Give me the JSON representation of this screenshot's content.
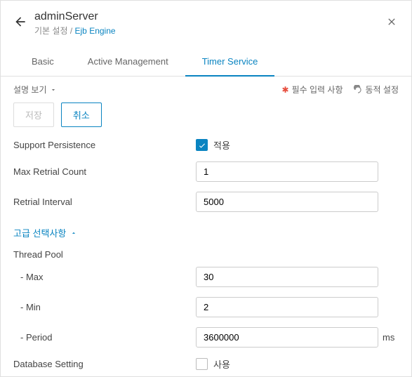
{
  "header": {
    "title": "adminServer",
    "breadcrumb_root": "기본 설정",
    "breadcrumb_sep": " / ",
    "breadcrumb_current": "Ejb Engine"
  },
  "tabs": {
    "t0": "Basic",
    "t1": "Active Management",
    "t2": "Timer Service"
  },
  "legend": {
    "view": "설명 보기",
    "required": "필수 입력 사항",
    "dynamic": "동적 설정"
  },
  "buttons": {
    "save": "저장",
    "cancel": "취소"
  },
  "fields": {
    "supportPersistence": {
      "label": "Support Persistence",
      "chkLabel": "적용"
    },
    "maxRetrial": {
      "label": "Max Retrial Count",
      "value": "1"
    },
    "retrialInterval": {
      "label": "Retrial Interval",
      "value": "5000"
    },
    "advanced": "고급 선택사항",
    "threadPool": "Thread Pool",
    "max": {
      "label": " - Max",
      "value": "30"
    },
    "min": {
      "label": " - Min",
      "value": "2"
    },
    "period": {
      "label": " - Period",
      "value": "3600000",
      "unit": "ms"
    },
    "dbSetting": {
      "label": "Database Setting",
      "chkLabel": "사용"
    }
  }
}
